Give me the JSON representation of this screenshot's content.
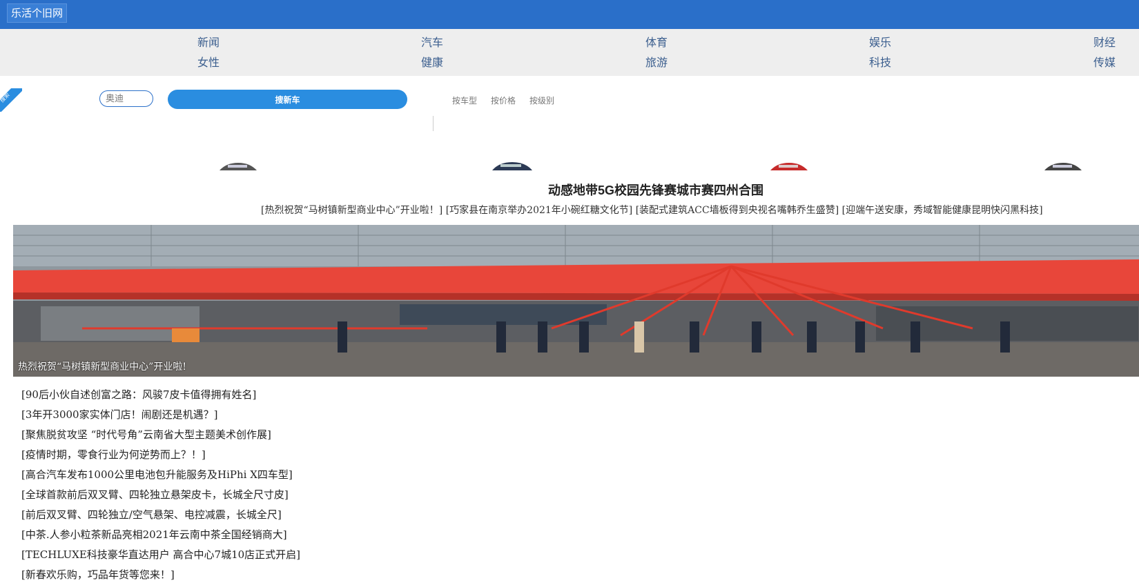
{
  "header": {
    "logo": "乐活个旧网"
  },
  "nav": {
    "row1": [
      "新闻",
      "汽车",
      "体育",
      "娱乐",
      "财经"
    ],
    "row2": [
      "女性",
      "健康",
      "旅游",
      "科技",
      "传媒"
    ]
  },
  "car_search": {
    "ribbon_label": "搜索",
    "input_placeholder": "奥迪",
    "button_label": "搜新车",
    "filters": [
      "按车型",
      "按价格",
      "按级别"
    ]
  },
  "headline": {
    "title": "动感地带5G校园先锋赛城市赛四州合围",
    "links": [
      "[热烈祝贺“马树镇新型商业中心”开业啦！]",
      "[巧家县在南京举办2021年小碗红糖文化节]",
      "[装配式建筑ACC墙板得到央视名嘴韩乔生盛赞]",
      "[迎端午送安康，秀域智能健康昆明快闪黑科技]"
    ]
  },
  "banner": {
    "caption": "热烈祝贺“马树镇新型商业中心”开业啦!",
    "colors": {
      "ribbon": "#e8463a",
      "sky": "#9aa4ad",
      "ground": "#6e6a66"
    }
  },
  "news": [
    "[90后小伙自述创富之路：风骏7皮卡值得拥有姓名]",
    "[3年开3000家实体门店！闹剧还是机遇？]",
    "[聚焦脱贫攻坚 “时代号角”云南省大型主题美术创作展]",
    "[疫情时期，零食行业为何逆势而上？！]",
    "[高合汽车发布1000公里电池包升能服务及HiPhi X四车型]",
    "[全球首款前后双叉臂、四轮独立悬架皮卡，长城全尺寸皮]",
    "[前后双叉臂、四轮独立/空气悬架、电控减震，长城全尺]",
    "[中茶.人参小粒茶新品亮相2021年云南中茶全国经销商大]",
    "[TECHLUXE科技豪华直达用户 高合中心7城10店正式开启]",
    "[新春欢乐购，巧品年货等您来！]"
  ],
  "colors": {
    "topbar": "#2a6fc9",
    "accent": "#2a8de0",
    "nav_bg": "#eeeeee",
    "nav_text": "#3b5e8e"
  }
}
